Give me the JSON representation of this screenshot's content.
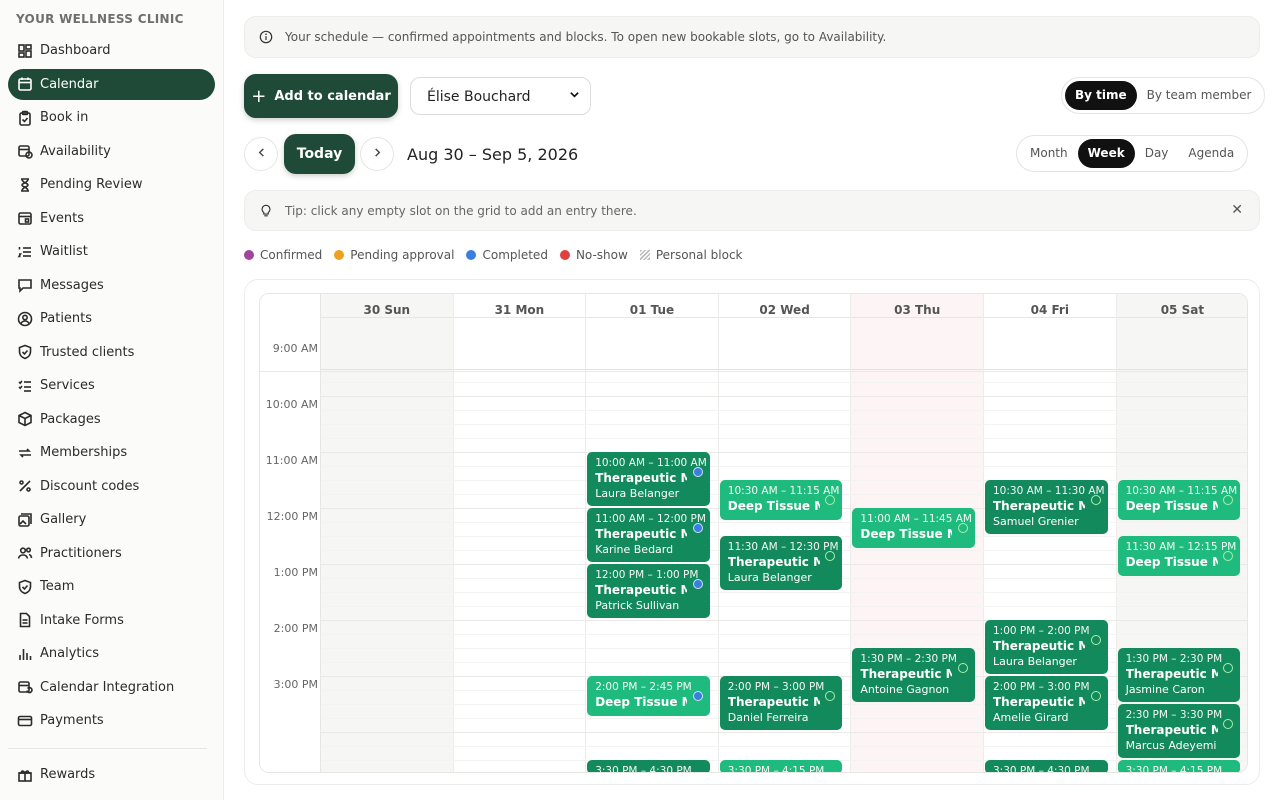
{
  "sidebar": {
    "brand": "YOUR WELLNESS CLINIC",
    "items": [
      {
        "label": "Dashboard",
        "icon": "dashboard-icon"
      },
      {
        "label": "Calendar",
        "icon": "calendar-icon",
        "active": true
      },
      {
        "label": "Book in",
        "icon": "clipboard-icon"
      },
      {
        "label": "Availability",
        "icon": "calendar-clock-icon"
      },
      {
        "label": "Pending Review",
        "icon": "hourglass-icon"
      },
      {
        "label": "Events",
        "icon": "calendar-event-icon"
      },
      {
        "label": "Waitlist",
        "icon": "list-ordered-icon"
      },
      {
        "label": "Messages",
        "icon": "message-icon"
      },
      {
        "label": "Patients",
        "icon": "user-circle-icon"
      },
      {
        "label": "Trusted clients",
        "icon": "shield-check-icon"
      },
      {
        "label": "Services",
        "icon": "list-check-icon"
      },
      {
        "label": "Packages",
        "icon": "package-icon"
      },
      {
        "label": "Memberships",
        "icon": "repeat-icon"
      },
      {
        "label": "Discount codes",
        "icon": "percent-icon"
      },
      {
        "label": "Gallery",
        "icon": "gallery-icon"
      },
      {
        "label": "Practitioners",
        "icon": "users-icon"
      },
      {
        "label": "Team",
        "icon": "shield-icon"
      },
      {
        "label": "Intake Forms",
        "icon": "document-icon"
      },
      {
        "label": "Analytics",
        "icon": "bar-chart-icon"
      },
      {
        "label": "Calendar Integration",
        "icon": "calendar-sync-icon"
      },
      {
        "label": "Payments",
        "icon": "credit-card-icon"
      }
    ],
    "secondary": [
      {
        "label": "Rewards",
        "icon": "gift-icon"
      }
    ]
  },
  "infobar": {
    "text": "Your schedule — confirmed appointments and blocks. To open new bookable slots, go to Availability."
  },
  "toolbar": {
    "add_label": "Add to calendar",
    "practitioner": "Élise Bouchard",
    "view_by": [
      "By time",
      "By team member"
    ],
    "view_by_selected": "By time",
    "today_label": "Today",
    "range": "Aug 30 – Sep 5, 2026",
    "views": [
      "Month",
      "Week",
      "Day",
      "Agenda"
    ],
    "view_selected": "Week"
  },
  "tip": {
    "text": "Tip: click any empty slot on the grid to add an entry there."
  },
  "legend": [
    {
      "label": "Confirmed",
      "color": "#a0449c"
    },
    {
      "label": "Pending approval",
      "color": "#f0a020"
    },
    {
      "label": "Completed",
      "color": "#3a7fe0"
    },
    {
      "label": "No-show",
      "color": "#e04040"
    },
    {
      "label": "Personal block",
      "color": "hatch"
    }
  ],
  "calendar": {
    "days": [
      "30 Sun",
      "31 Mon",
      "01 Tue",
      "02 Wed",
      "03 Thu",
      "04 Fri",
      "05 Sat"
    ],
    "today_index": 4,
    "times": [
      "9:00 AM",
      "10:00 AM",
      "11:00 AM",
      "12:00 PM",
      "1:00 PM",
      "2:00 PM",
      "3:00 PM"
    ],
    "events": [
      {
        "day": 2,
        "start": 10.0,
        "end": 11.0,
        "time": "10:00 AM – 11:00 AM",
        "title": "Therapeutic M...",
        "person": "Laura Belanger",
        "status": "completed"
      },
      {
        "day": 2,
        "start": 11.0,
        "end": 12.0,
        "time": "11:00 AM – 12:00 PM",
        "title": "Therapeutic M...",
        "person": "Karine Bedard",
        "status": "completed"
      },
      {
        "day": 2,
        "start": 12.0,
        "end": 13.0,
        "time": "12:00 PM – 1:00 PM",
        "title": "Therapeutic M...",
        "person": "Patrick Sullivan",
        "status": "completed"
      },
      {
        "day": 2,
        "start": 14.0,
        "end": 14.75,
        "time": "2:00 PM – 2:45 PM",
        "title": "Deep Tissue M...",
        "person": "",
        "status": "completed",
        "light": true
      },
      {
        "day": 2,
        "start": 15.5,
        "end": 16.5,
        "time": "3:30 PM – 4:30 PM",
        "title": "",
        "person": "",
        "status": "completed"
      },
      {
        "day": 3,
        "start": 10.5,
        "end": 11.25,
        "time": "10:30 AM – 11:15 AM",
        "title": "Deep Tissue M...",
        "person": "",
        "status": "confirmed",
        "light": true
      },
      {
        "day": 3,
        "start": 11.5,
        "end": 12.5,
        "time": "11:30 AM – 12:30 PM",
        "title": "Therapeutic M...",
        "person": "Laura Belanger",
        "status": "confirmed"
      },
      {
        "day": 3,
        "start": 14.0,
        "end": 15.0,
        "time": "2:00 PM – 3:00 PM",
        "title": "Therapeutic M...",
        "person": "Daniel Ferreira",
        "status": "confirmed"
      },
      {
        "day": 3,
        "start": 15.5,
        "end": 16.25,
        "time": "3:30 PM – 4:15 PM",
        "title": "",
        "person": "",
        "status": "confirmed",
        "light": true
      },
      {
        "day": 4,
        "start": 11.0,
        "end": 11.75,
        "time": "11:00 AM – 11:45 AM",
        "title": "Deep Tissue M...",
        "person": "",
        "status": "confirmed",
        "light": true
      },
      {
        "day": 4,
        "start": 13.5,
        "end": 14.5,
        "time": "1:30 PM – 2:30 PM",
        "title": "Therapeutic M...",
        "person": "Antoine Gagnon",
        "status": "confirmed"
      },
      {
        "day": 5,
        "start": 10.5,
        "end": 11.5,
        "time": "10:30 AM – 11:30 AM",
        "title": "Therapeutic M...",
        "person": "Samuel Grenier",
        "status": "confirmed"
      },
      {
        "day": 5,
        "start": 13.0,
        "end": 14.0,
        "time": "1:00 PM – 2:00 PM",
        "title": "Therapeutic M...",
        "person": "Laura Belanger",
        "status": "confirmed"
      },
      {
        "day": 5,
        "start": 14.0,
        "end": 15.0,
        "time": "2:00 PM – 3:00 PM",
        "title": "Therapeutic M...",
        "person": "Amelie Girard",
        "status": "confirmed"
      },
      {
        "day": 5,
        "start": 15.5,
        "end": 16.5,
        "time": "3:30 PM – 4:30 PM",
        "title": "",
        "person": "",
        "status": "confirmed"
      },
      {
        "day": 6,
        "start": 10.5,
        "end": 11.25,
        "time": "10:30 AM – 11:15 AM",
        "title": "Deep Tissue M...",
        "person": "",
        "status": "confirmed",
        "light": true
      },
      {
        "day": 6,
        "start": 11.5,
        "end": 12.25,
        "time": "11:30 AM – 12:15 PM",
        "title": "Deep Tissue M...",
        "person": "",
        "status": "confirmed",
        "light": true
      },
      {
        "day": 6,
        "start": 13.5,
        "end": 14.5,
        "time": "1:30 PM – 2:30 PM",
        "title": "Therapeutic M...",
        "person": "Jasmine Caron",
        "status": "confirmed"
      },
      {
        "day": 6,
        "start": 14.5,
        "end": 15.5,
        "time": "2:30 PM – 3:30 PM",
        "title": "Therapeutic M...",
        "person": "Marcus Adeyemi",
        "status": "confirmed"
      },
      {
        "day": 6,
        "start": 15.5,
        "end": 16.25,
        "time": "3:30 PM – 4:15 PM",
        "title": "",
        "person": "",
        "status": "confirmed",
        "light": true
      }
    ]
  }
}
